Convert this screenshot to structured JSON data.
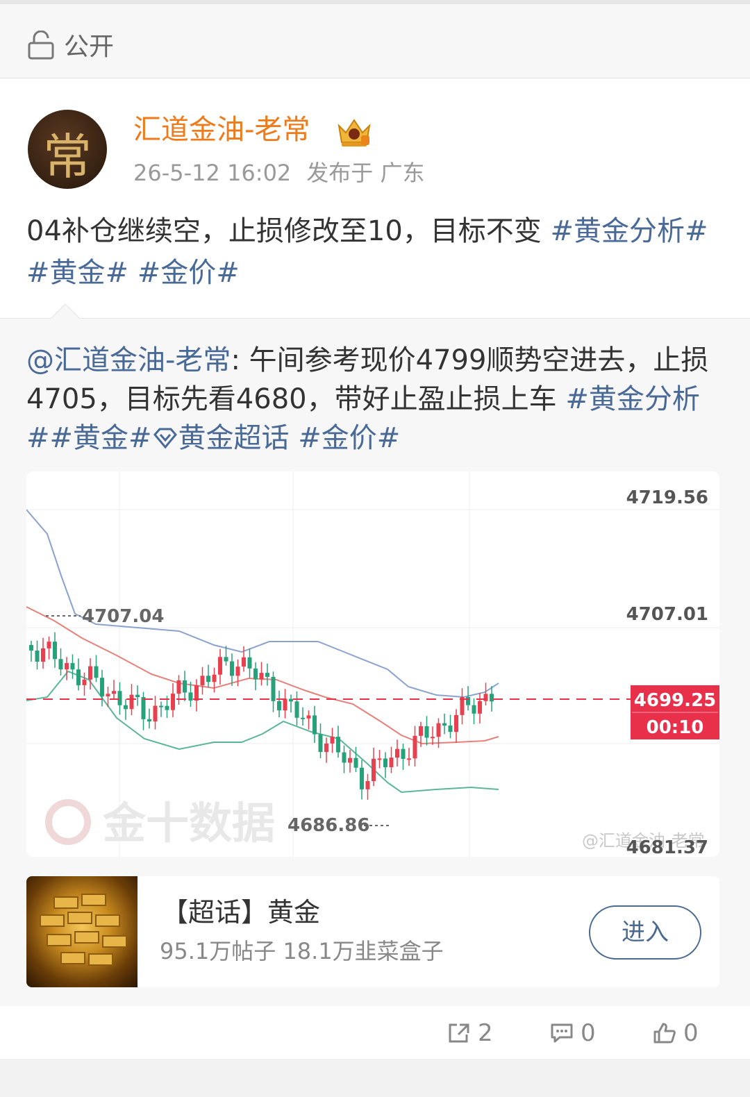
{
  "visibility": {
    "label": "公开"
  },
  "post": {
    "avatar_char": "常",
    "author": "汇道金油-老常",
    "timestamp": "26-5-12 16:02",
    "location": "发布于 广东",
    "text_plain": "04补仓继续空，止损修改至10，目标不变",
    "tags": [
      "#黄金分析#",
      "#黄金#",
      "#金价#"
    ]
  },
  "repost": {
    "mention": "@汇道金油-老常",
    "text_plain": ": 午间参考现价4799顺势空进去，止损4705，目标先看4680，带好止盈止损上车",
    "tags_a": "#黄金分析##黄金#",
    "tag_super": "黄金超话",
    "tags_b": "#金价#"
  },
  "chart": {
    "price_labels": [
      "4719.56",
      "4707.01",
      "4681.37"
    ],
    "current_price": "4699.25",
    "countdown": "00:10",
    "high_marker": "4707.04",
    "low_marker": "4686.86",
    "watermark_source": "金十数据",
    "watermark_author": "@汇道金油-老常",
    "colors": {
      "up": "#e8404e",
      "down": "#27a17a",
      "upper_band": "#8aa2cf",
      "mid_band": "#e8807a",
      "lower_band": "#5bb59a",
      "current": "#e8304a"
    }
  },
  "chart_data": {
    "type": "candlestick",
    "ylim": [
      4681.37,
      4719.56
    ],
    "current_price": 4699.25,
    "high_marker": 4707.04,
    "low_marker": 4686.86
  },
  "topic": {
    "title": "【超话】黄金",
    "stats": "95.1万帖子 18.1万韭菜盒子",
    "enter_label": "进入"
  },
  "actions": {
    "repost_count": "2",
    "comment_count": "0",
    "like_count": "0"
  }
}
